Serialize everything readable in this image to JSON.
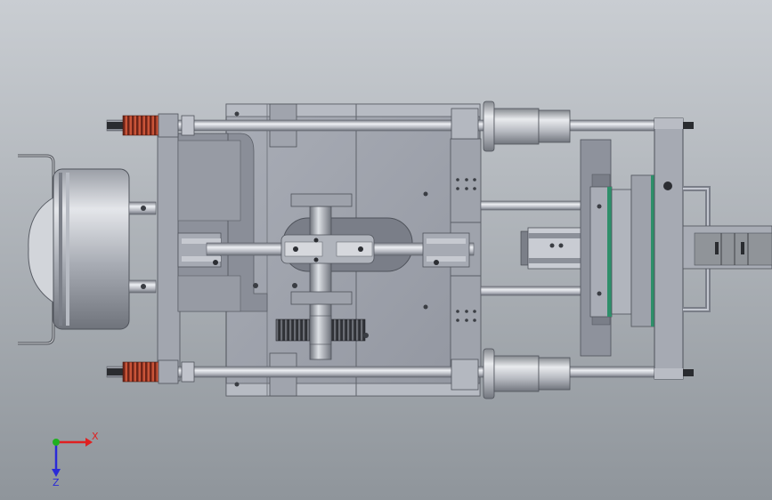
{
  "viewport": {
    "background_top": "#c9cdd2",
    "background_bottom": "#8f959b"
  },
  "triad": {
    "x_label": "X",
    "z_label": "Z",
    "x_color": "#e02020",
    "y_color": "#21b021",
    "z_color": "#2a2ad8"
  },
  "colors": {
    "metal_light": "#c3c6cf",
    "metal_mid": "#9da1ab",
    "metal_dark": "#6e727c",
    "spring": "#b2402c",
    "gear": "#33353a",
    "accent_green": "#2e8f6a"
  }
}
